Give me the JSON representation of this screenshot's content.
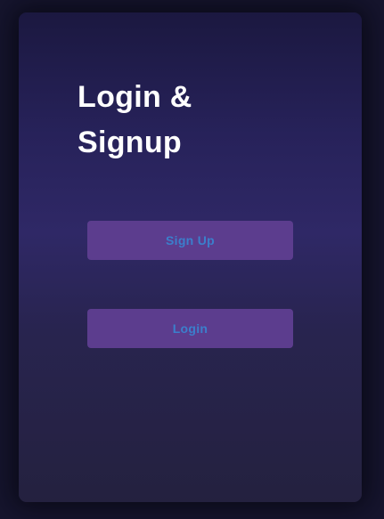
{
  "card": {
    "title": "Login & Signup"
  },
  "buttons": {
    "signup_label": "Sign Up",
    "login_label": "Login"
  },
  "colors": {
    "page_background": "#16152e",
    "card_gradient_top": "#1b1840",
    "card_gradient_mid": "#2f2866",
    "card_gradient_bottom": "#24213f",
    "button_background": "#5c3d8e",
    "button_text": "#3b7fcc",
    "title_text": "#ffffff"
  }
}
